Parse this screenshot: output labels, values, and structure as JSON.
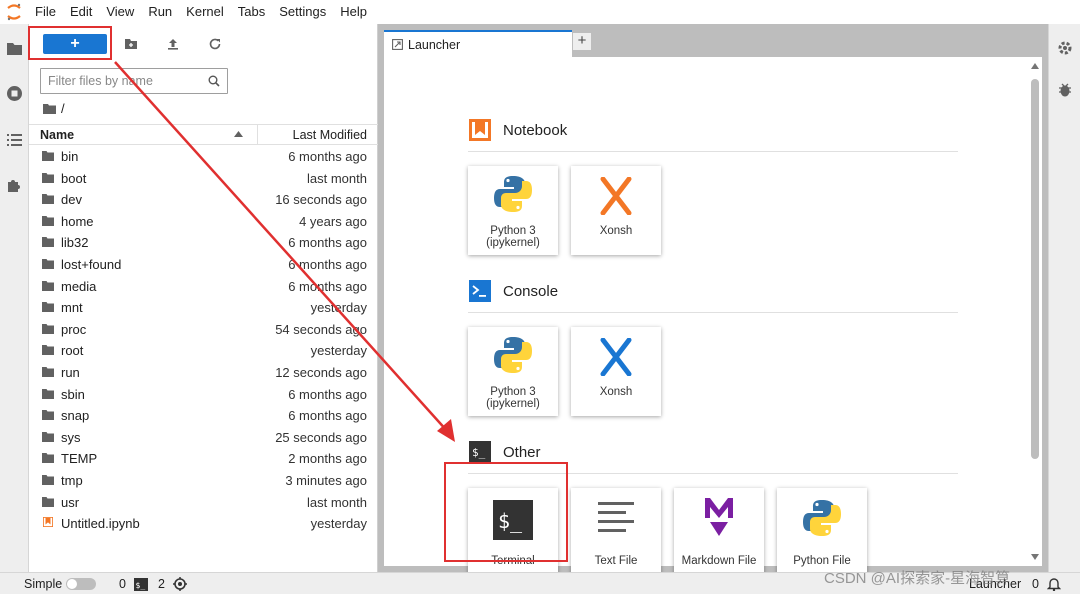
{
  "menu": [
    "File",
    "Edit",
    "View",
    "Run",
    "Kernel",
    "Tabs",
    "Settings",
    "Help"
  ],
  "filebrowser": {
    "new_label": "+",
    "filter_placeholder": "Filter files by name",
    "breadcrumb": "/",
    "columns": {
      "name": "Name",
      "modified": "Last Modified"
    },
    "files": [
      {
        "name": "bin",
        "modified": "6 months ago",
        "type": "folder"
      },
      {
        "name": "boot",
        "modified": "last month",
        "type": "folder"
      },
      {
        "name": "dev",
        "modified": "16 seconds ago",
        "type": "folder"
      },
      {
        "name": "home",
        "modified": "4 years ago",
        "type": "folder"
      },
      {
        "name": "lib32",
        "modified": "6 months ago",
        "type": "folder"
      },
      {
        "name": "lost+found",
        "modified": "6 months ago",
        "type": "folder"
      },
      {
        "name": "media",
        "modified": "6 months ago",
        "type": "folder"
      },
      {
        "name": "mnt",
        "modified": "yesterday",
        "type": "folder"
      },
      {
        "name": "proc",
        "modified": "54 seconds ago",
        "type": "folder"
      },
      {
        "name": "root",
        "modified": "yesterday",
        "type": "folder"
      },
      {
        "name": "run",
        "modified": "12 seconds ago",
        "type": "folder"
      },
      {
        "name": "sbin",
        "modified": "6 months ago",
        "type": "folder"
      },
      {
        "name": "snap",
        "modified": "6 months ago",
        "type": "folder"
      },
      {
        "name": "sys",
        "modified": "25 seconds ago",
        "type": "folder"
      },
      {
        "name": "TEMP",
        "modified": "2 months ago",
        "type": "folder"
      },
      {
        "name": "tmp",
        "modified": "3 minutes ago",
        "type": "folder"
      },
      {
        "name": "usr",
        "modified": "last month",
        "type": "folder"
      },
      {
        "name": "Untitled.ipynb",
        "modified": "yesterday",
        "type": "notebook"
      }
    ]
  },
  "tabs": [
    {
      "label": "Launcher"
    }
  ],
  "tab_add": "+",
  "launcher": {
    "sections": {
      "notebook": {
        "title": "Notebook",
        "cards": [
          "Python 3\n(ipykernel)",
          "Xonsh"
        ]
      },
      "console": {
        "title": "Console",
        "cards": [
          "Python 3\n(ipykernel)",
          "Xonsh"
        ]
      },
      "other": {
        "title": "Other",
        "cards": [
          "Terminal",
          "Text File",
          "Markdown File",
          "Python File"
        ]
      }
    }
  },
  "statusbar": {
    "mode": "Simple",
    "kernels": "0",
    "terminals": "2",
    "activity": "Launcher",
    "notifications": "0"
  },
  "watermark": "CSDN @AI探索家-星海智算",
  "colors": {
    "accent": "#1976d2",
    "annotation": "#e03030",
    "orange": "#f37726"
  }
}
